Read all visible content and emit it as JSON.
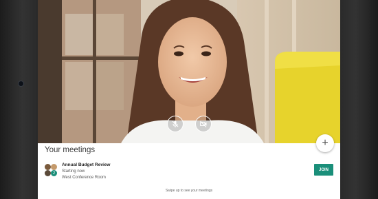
{
  "sheet": {
    "title": "Your meetings"
  },
  "meeting": {
    "title": "Annual Budget Review",
    "status": "Starting now",
    "room": "West Conference Room",
    "extra_count": "2",
    "join_label": "JOIN"
  },
  "hint": "Swipe up to see your meetings",
  "fab_label": "+",
  "icons": [
    "mic-off-icon",
    "camera-off-icon",
    "add-icon"
  ],
  "colors": {
    "accent": "#1a8f7a",
    "sheet_bg": "#ffffff"
  }
}
